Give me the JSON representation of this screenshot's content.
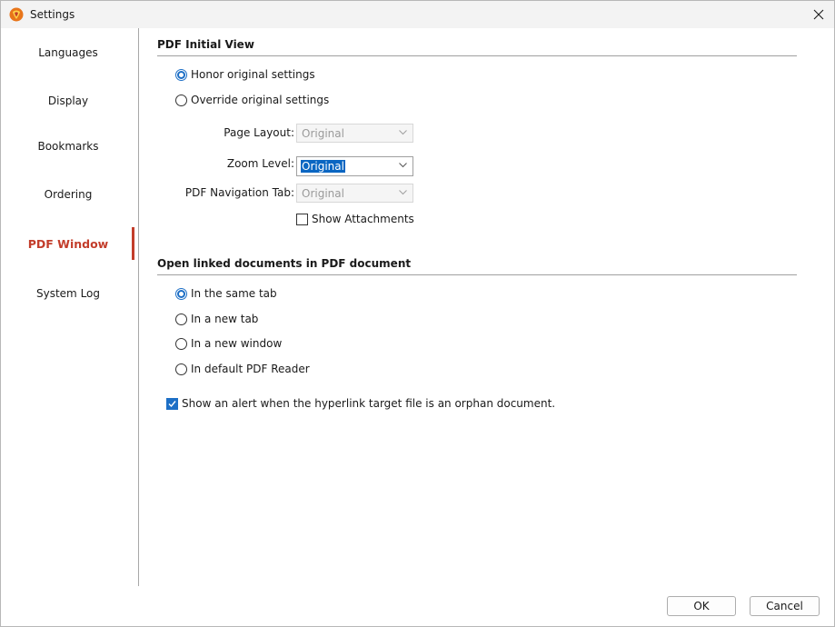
{
  "window": {
    "title": "Settings"
  },
  "sidebar": {
    "items": [
      {
        "label": "Languages"
      },
      {
        "label": "Display"
      },
      {
        "label": "Bookmarks"
      },
      {
        "label": "Ordering"
      },
      {
        "label": "PDF Window",
        "active": true
      },
      {
        "label": "System Log"
      }
    ]
  },
  "initial_view": {
    "title": "PDF Initial View",
    "honor_label": "Honor original settings",
    "override_label": "Override original settings",
    "selected": "honor",
    "page_layout": {
      "label": "Page Layout:",
      "value": "Original"
    },
    "zoom_level": {
      "label": "Zoom Level:",
      "value": "Original"
    },
    "nav_tab": {
      "label": "PDF Navigation Tab:",
      "value": "Original"
    },
    "show_attachments": {
      "label": "Show Attachments",
      "checked": false
    }
  },
  "linked_docs": {
    "title": "Open linked documents in PDF document",
    "options": [
      {
        "label": "In the same tab",
        "checked": true
      },
      {
        "label": "In a new tab",
        "checked": false
      },
      {
        "label": "In a new window",
        "checked": false
      },
      {
        "label": "In default PDF Reader",
        "checked": false
      }
    ],
    "alert": {
      "label": "Show an alert when the hyperlink target file is an orphan document.",
      "checked": true
    }
  },
  "footer": {
    "ok": "OK",
    "cancel": "Cancel"
  },
  "colors": {
    "accent": "#c33d2b",
    "selection": "#1d6fc6"
  }
}
